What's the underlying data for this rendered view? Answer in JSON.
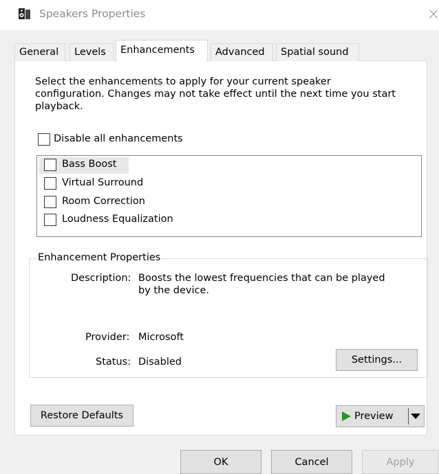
{
  "window": {
    "title": "Speakers Properties",
    "icon": "speaker-icon",
    "close_glyph": "×"
  },
  "tabs": [
    {
      "label": "General"
    },
    {
      "label": "Levels"
    },
    {
      "label": "Enhancements",
      "active": true
    },
    {
      "label": "Advanced"
    },
    {
      "label": "Spatial sound"
    }
  ],
  "intro": {
    "line1": "Select the enhancements to apply for your current speaker",
    "line2": "configuration. Changes may not take effect until the next time you start",
    "line3": "playback."
  },
  "disable_all": {
    "label": "Disable all enhancements",
    "checked": false
  },
  "enhancements": [
    {
      "label": "Bass Boost",
      "checked": false
    },
    {
      "label": "Virtual Surround",
      "checked": false
    },
    {
      "label": "Room Correction",
      "checked": false
    },
    {
      "label": "Loudness Equalization",
      "checked": false
    }
  ],
  "properties": {
    "group_title": "Enhancement Properties",
    "description_label": "Description:",
    "description_line1": "Boosts the lowest frequencies that can be played",
    "description_line2": "by the device.",
    "provider_label": "Provider:",
    "provider_value": "Microsoft",
    "status_label": "Status:",
    "status_value": "Disabled",
    "settings_button": "Settings..."
  },
  "restore_defaults_button": "Restore Defaults",
  "preview": {
    "label": "Preview",
    "play_icon": "play-icon",
    "dropdown_icon": "dropdown-arrow-icon",
    "accent": "#1e9b1e"
  },
  "footer": {
    "ok": "OK",
    "cancel": "Cancel",
    "apply": "Apply",
    "apply_enabled": false
  }
}
